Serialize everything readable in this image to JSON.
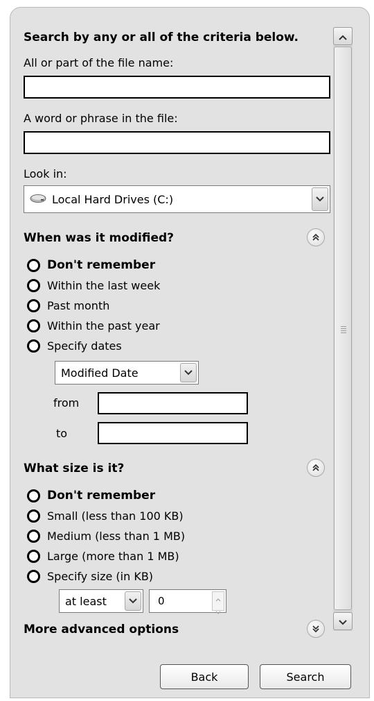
{
  "search": {
    "heading": "Search by any or all of the criteria below.",
    "file_name_label": "All or part of the file name:",
    "file_name_value": "",
    "phrase_label": "A word or phrase in the file:",
    "phrase_value": "",
    "look_in_label": "Look in:",
    "look_in_value": "Local Hard Drives (C:)",
    "look_in_icon": "hard-drive-icon"
  },
  "modified": {
    "heading": "When was it modified?",
    "options": [
      "Don't remember",
      "Within the last week",
      "Past month",
      "Within the past year",
      "Specify dates"
    ],
    "date_type_value": "Modified Date",
    "from_label": "from",
    "from_value": "",
    "to_label": "to",
    "to_value": ""
  },
  "size": {
    "heading": "What size is it?",
    "options": [
      "Don't remember",
      "Small (less than 100 KB)",
      "Medium (less than 1 MB)",
      "Large (more than 1 MB)",
      "Specify size (in KB)"
    ],
    "qualifier_value": "at least",
    "amount_value": "0"
  },
  "advanced": {
    "heading": "More advanced options"
  },
  "buttons": {
    "back_label": "Back",
    "search_label": "Search"
  }
}
